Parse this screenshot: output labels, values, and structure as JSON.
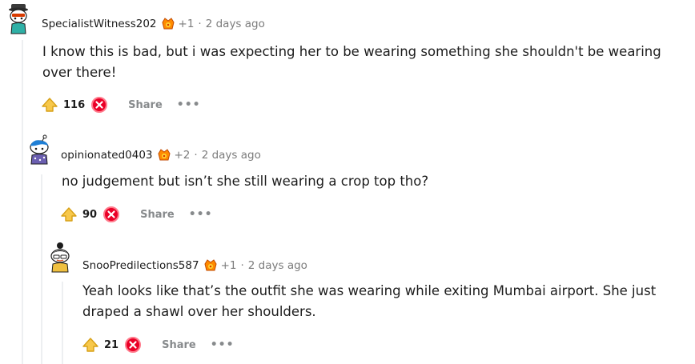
{
  "comments": [
    {
      "username": "SpecialistWitness202",
      "award_count": "+1",
      "time": "2 days ago",
      "body_lines": [
        "I know this is bad, but i was expecting her to be wearing something she shouldn't be wearing",
        "over there!"
      ],
      "score": "116",
      "share_label": "Share",
      "more_label": "•••"
    },
    {
      "username": "opinionated0403",
      "award_count": "+2",
      "time": "2 days ago",
      "body_lines": [
        "no judgement but isn’t she still wearing a crop top tho?"
      ],
      "score": "90",
      "share_label": "Share",
      "more_label": "•••"
    },
    {
      "username": "SnooPredilections587",
      "award_count": "+1",
      "time": "2 days ago",
      "body_lines": [
        "Yeah looks like that’s the outfit she was wearing while exiting Mumbai airport. She just",
        "draped a shawl over her shoulders."
      ],
      "score": "21",
      "share_label": "Share",
      "more_label": "•••"
    }
  ],
  "dot_separator": "·",
  "icons": {
    "upvote": "upvote-icon",
    "downvote": "downvote-icon",
    "award": "award-icon",
    "avatar": "snoo-avatar"
  },
  "colors": {
    "upvote_fill": "#f7c84b",
    "downvote_fill": "#ea0027",
    "meta_text": "#7c7c7c",
    "action_text": "#878a8c",
    "thread_line": "#edeff1"
  }
}
